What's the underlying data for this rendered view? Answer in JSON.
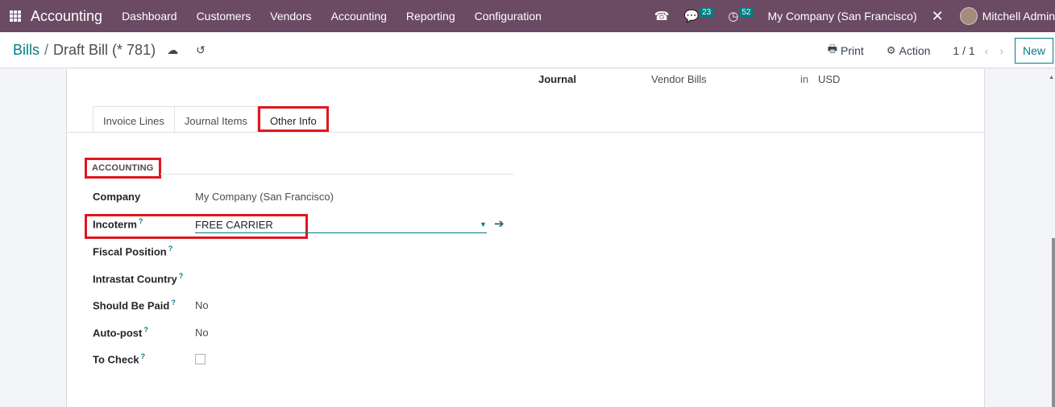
{
  "navbar": {
    "app_name": "Accounting",
    "menu": [
      "Dashboard",
      "Customers",
      "Vendors",
      "Accounting",
      "Reporting",
      "Configuration"
    ],
    "messages_count": "23",
    "activities_count": "52",
    "company": "My Company (San Francisco)",
    "user": "Mitchell Admin",
    "icons": {
      "apps": "apps-grid-icon",
      "phone": "phone-icon",
      "messages": "chat-icon",
      "activities": "clock-icon",
      "debug": "tools-icon"
    }
  },
  "control_panel": {
    "breadcrumb_parent": "Bills",
    "breadcrumb_separator": "/",
    "breadcrumb_current": "Draft Bill (* 781)",
    "save_icon": "☁",
    "discard_icon": "↺",
    "print_label": "Print",
    "action_label": "Action",
    "pager": "1 / 1",
    "prev_icon": "‹",
    "next_icon": "›",
    "new_label": "New"
  },
  "header_fields": {
    "journal_label": "Journal",
    "journal_value": "Vendor Bills",
    "in_label": "in",
    "currency": "USD"
  },
  "tabs": [
    {
      "label": "Invoice Lines",
      "active": false
    },
    {
      "label": "Journal Items",
      "active": false
    },
    {
      "label": "Other Info",
      "active": true
    }
  ],
  "accounting_section": {
    "title": "ACCOUNTING",
    "fields": {
      "company": {
        "label": "Company",
        "value": "My Company (San Francisco)"
      },
      "incoterm": {
        "label": "Incoterm",
        "value": "FREE CARRIER"
      },
      "fiscal_position": {
        "label": "Fiscal Position",
        "value": ""
      },
      "intrastat_country": {
        "label": "Intrastat Country",
        "value": ""
      },
      "should_be_paid": {
        "label": "Should Be Paid",
        "value": "No"
      },
      "auto_post": {
        "label": "Auto-post",
        "value": "No"
      },
      "to_check": {
        "label": "To Check",
        "checked": false
      }
    },
    "help_marker": "?"
  },
  "colors": {
    "navbar": "#6b4a63",
    "accent": "#017e84",
    "highlight": "#e0161e"
  }
}
